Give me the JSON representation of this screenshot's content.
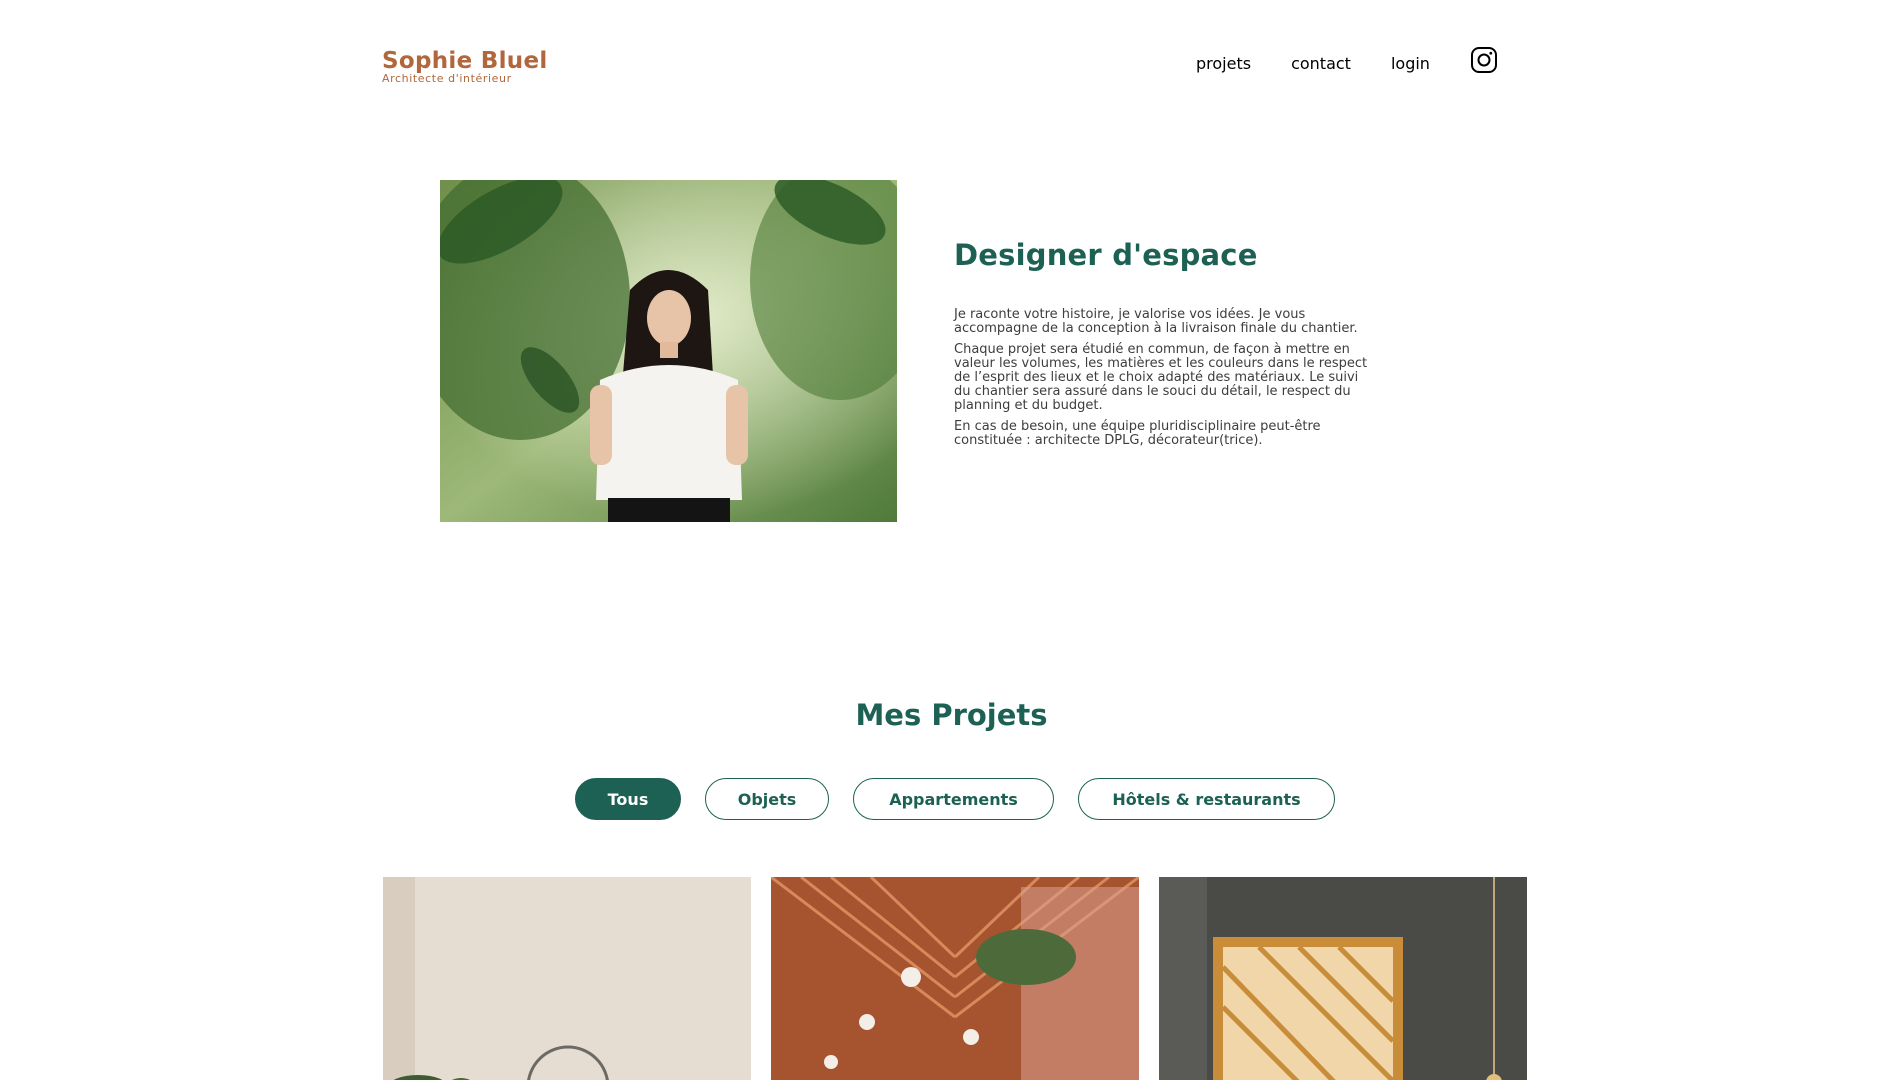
{
  "header": {
    "logo_name": "Sophie Bluel",
    "logo_subtitle": "Architecte d'intérieur",
    "nav": {
      "projects": "projets",
      "contact": "contact",
      "login": "login"
    },
    "social_icon": "instagram-icon"
  },
  "intro": {
    "title": "Designer d'espace",
    "paragraphs": [
      "Je raconte votre histoire, je valorise vos idées. Je vous accompagne de la conception à la livraison finale du chantier.",
      "Chaque projet sera étudié en commun, de façon à mettre en valeur les volumes, les matières et les couleurs dans le respect de l’esprit des lieux et le choix adapté des matériaux. Le suivi du chantier sera assuré dans le souci du détail, le respect du planning et du budget.",
      "En cas de besoin, une équipe pluridisciplinaire peut-être constituée : architecte DPLG, décorateur(trice)."
    ]
  },
  "projects": {
    "title": "Mes Projets",
    "filters": [
      "Tous",
      "Objets",
      "Appartements",
      "Hôtels & restaurants"
    ],
    "active_filter": "Tous"
  },
  "colors": {
    "brand": "#b1663c",
    "accent": "#1d6154",
    "text": "#3d3d3d"
  }
}
